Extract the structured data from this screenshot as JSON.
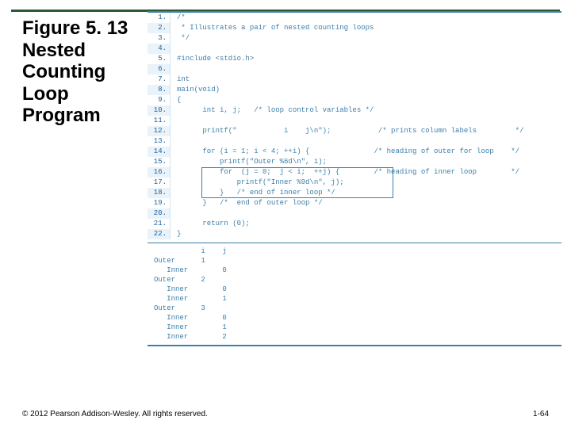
{
  "title": "Figure 5. 13 Nested Counting Loop Program",
  "footer": "© 2012 Pearson Addison-Wesley. All rights reserved.",
  "slidenum": "1-64",
  "code": {
    "lines": [
      "/*",
      " * Illustrates a pair of nested counting loops",
      " */",
      "",
      "#include <stdio.h>",
      "",
      "int",
      "main(void)",
      "{",
      "      int i, j;   /* loop control variables */",
      "",
      "      printf(\"           i    j\\n\");           /* prints column labels         */",
      "",
      "      for (i = 1; i < 4; ++i) {               /* heading of outer for loop    */",
      "          printf(\"Outer %6d\\n\", i);",
      "          for  (j = 0;  j < i;  ++j) {        /* heading of inner loop        */",
      "              printf(\"Inner %9d\\n\", j);",
      "          }   /* end of inner loop */",
      "      }   /*  end of outer loop */",
      "",
      "      return (0);",
      "}"
    ]
  },
  "output": [
    "           i    j",
    "Outer      1",
    "   Inner        0",
    "Outer      2",
    "   Inner        0",
    "   Inner        1",
    "Outer      3",
    "   Inner        0",
    "   Inner        1",
    "   Inner        2"
  ]
}
